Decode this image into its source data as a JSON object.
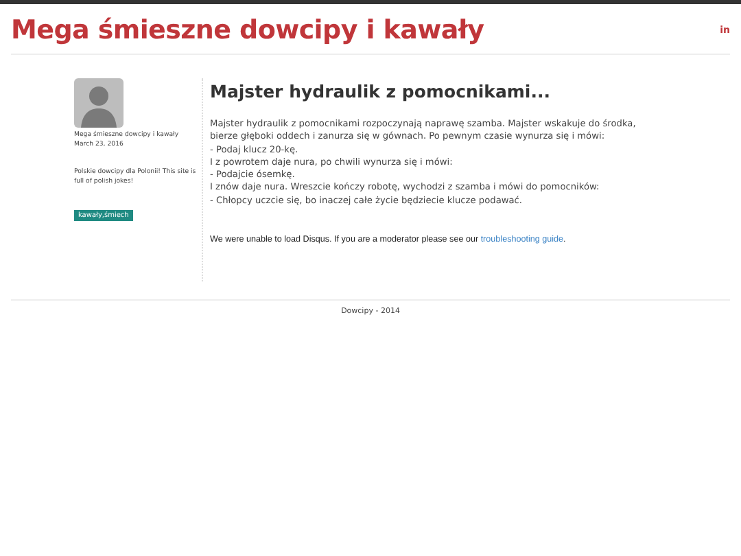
{
  "site_title": "Mega śmieszne dowcipy i kawały",
  "social": {
    "label": "in"
  },
  "author": {
    "name": "Mega śmieszne dowcipy i kawały",
    "date": "March 23, 2016",
    "bio": "Polskie dowcipy dla Polonii! This site is full of polish jokes!",
    "tag": "kawały,śmiech"
  },
  "post": {
    "title": "Majster hydraulik z pomocnikami...",
    "lines": [
      "Majster hydraulik z pomocnikami rozpoczynają naprawę szamba. Majster wskakuje do środka, bierze głęboki oddech i zanurza się w gównach. Po pewnym czasie wynurza się i mówi:",
      "- Podaj klucz 20-kę.",
      "I z powrotem daje nura, po chwili wynurza się i mówi:",
      "- Podajcie ósemkę.",
      "I znów daje nura. Wreszcie kończy robotę, wychodzi z szamba i mówi do pomocników:",
      "- Chłopcy uczcie się, bo inaczej całe życie będziecie klucze podawać."
    ]
  },
  "comments": {
    "message": "We were unable to load Disqus. If you are a moderator please see our ",
    "link": "troubleshooting guide",
    "end": "."
  },
  "footer": "Dowcipy - 2014"
}
